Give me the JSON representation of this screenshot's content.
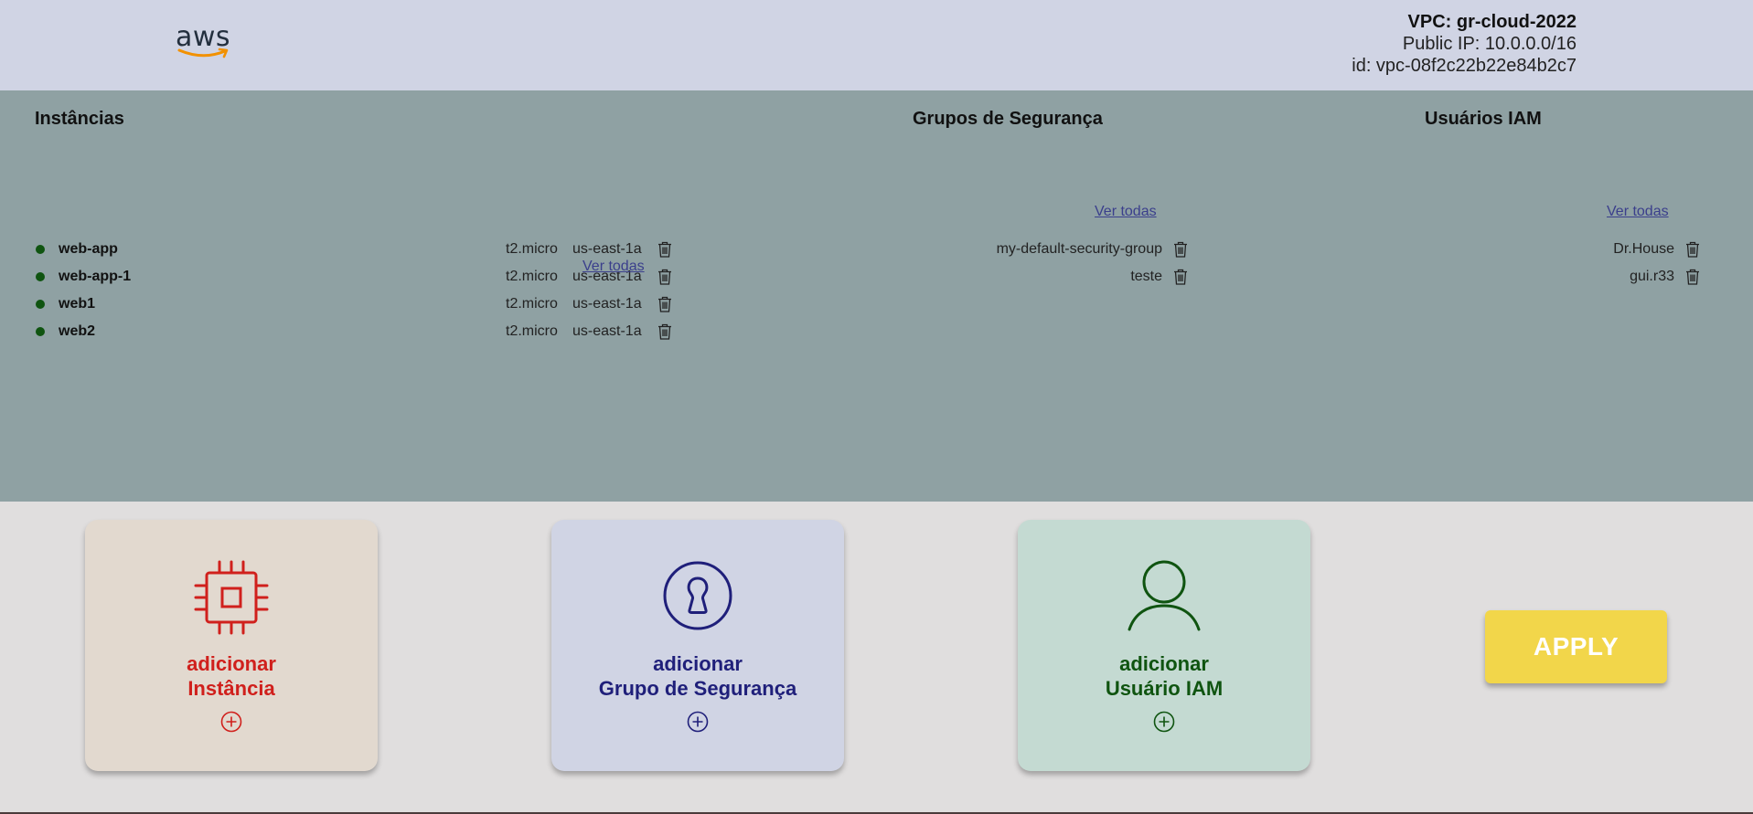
{
  "header": {
    "logo_text": "aws",
    "vpc_name": "VPC: gr-cloud-2022",
    "public_ip": "Public IP: 10.0.0.0/16",
    "vpc_id": "id: vpc-08f2c22b22e84b2c7"
  },
  "instances": {
    "title": "Instâncias",
    "items": [
      {
        "name": "web-app",
        "type": "t2.micro",
        "zone": "us-east-1a"
      },
      {
        "name": "web-app-1",
        "type": "t2.micro",
        "zone": "us-east-1a"
      },
      {
        "name": "web1",
        "type": "t2.micro",
        "zone": "us-east-1a"
      },
      {
        "name": "web2",
        "type": "t2.micro",
        "zone": "us-east-1a"
      }
    ],
    "see_all": "Ver todas",
    "status_color": "#0f5410"
  },
  "security_groups": {
    "title": "Grupos de Segurança",
    "items": [
      {
        "name": "my-default-security-group"
      },
      {
        "name": "teste"
      }
    ],
    "see_all": "Ver todas"
  },
  "iam_users": {
    "title": "Usuários IAM",
    "items": [
      {
        "name": "Dr.House"
      },
      {
        "name": "gui.r33"
      }
    ],
    "see_all": "Ver todas"
  },
  "cards": [
    {
      "line1": "adicionar",
      "line2": "Instância",
      "icon": "chip-icon",
      "color": "#d0201c",
      "bg": "#e2d9cf"
    },
    {
      "line1": "adicionar",
      "line2": "Grupo de Segurança",
      "icon": "lock-icon",
      "color": "#1f1f7a",
      "bg": "#d0d4e4"
    },
    {
      "line1": "adicionar",
      "line2": "Usuário IAM",
      "icon": "user-icon",
      "color": "#0f5410",
      "bg": "#c4dad2"
    }
  ],
  "apply_label": "APPLY",
  "colors": {
    "header_bg": "#d0d4e4",
    "panel_bg": "#8fa1a3",
    "page_bg": "#e0dede",
    "apply_bg": "#f2d64a",
    "link": "#3b3f8c"
  }
}
